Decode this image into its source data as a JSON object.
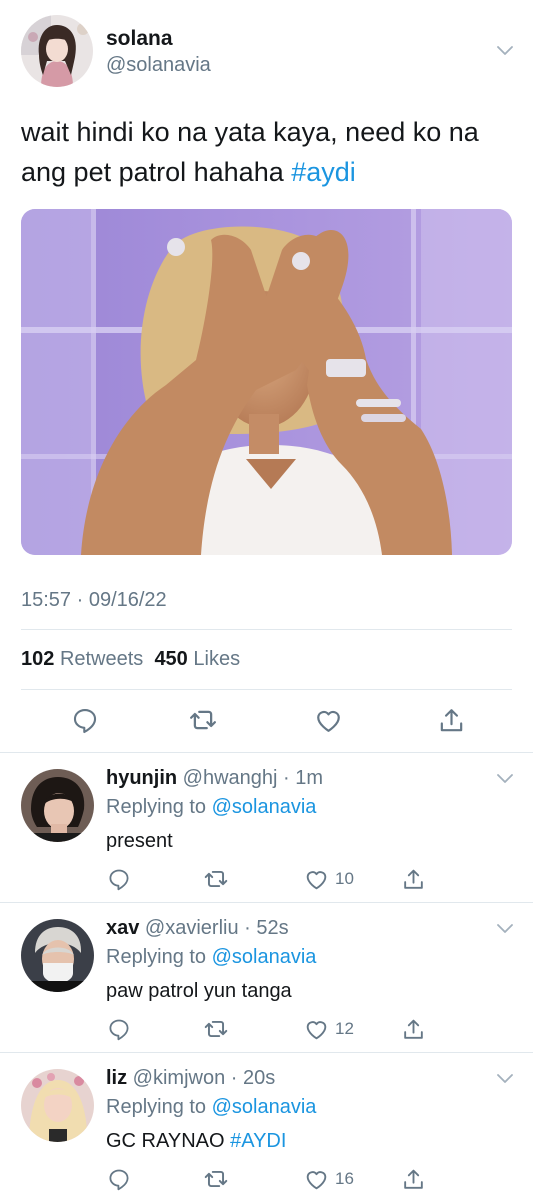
{
  "tweet": {
    "author_name": "solana",
    "author_handle": "@solanavia",
    "text": "wait hindi ko na yata kaya, need ko na ang pet patrol hahaha ",
    "hashtag": "#aydi",
    "timestamp": "15:57 · 09/16/22",
    "retweets_count": "102",
    "retweets_label": "Retweets",
    "likes_count": "450",
    "likes_label": "Likes"
  },
  "icons": {
    "reply": "speech-bubble-icon",
    "retweet": "retweet-arrows-icon",
    "like": "heart-icon",
    "share": "share-upload-icon",
    "more": "chevron-down-icon"
  },
  "colors": {
    "link": "#1b95e0",
    "secondary_text": "#657786",
    "primary_text": "#14171a",
    "divider": "#e1e8ed"
  },
  "replies": [
    {
      "name": "hyunjin",
      "meta": " @hwanghj · 1m",
      "replying_prefix": "Replying to ",
      "replying_to": "@solanavia",
      "text": "present",
      "hashtag": "",
      "like_count": "10"
    },
    {
      "name": "xav",
      "meta": " @xavierliu · 52s",
      "replying_prefix": "Replying to ",
      "replying_to": "@solanavia",
      "text": "paw patrol yun tanga",
      "hashtag": "",
      "like_count": "12"
    },
    {
      "name": "liz",
      "meta": " @kimjwon · 20s",
      "replying_prefix": "Replying to ",
      "replying_to": "@solanavia",
      "text": "GC RAYNAO ",
      "hashtag": "#AYDI",
      "like_count": "16"
    }
  ]
}
